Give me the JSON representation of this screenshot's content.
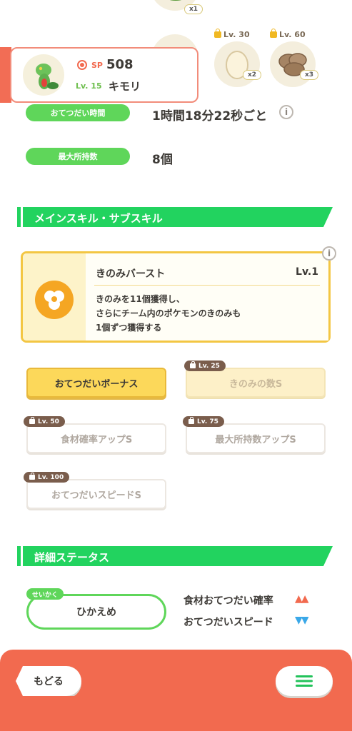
{
  "ingredients": {
    "items": [
      {
        "quantity": "x1"
      },
      {
        "unlock_level": "Lv. 30",
        "quantity": "x2"
      },
      {
        "unlock_level": "Lv. 60",
        "quantity": "x3"
      }
    ]
  },
  "pokemon": {
    "sp_label": "SP",
    "sp_value": "508",
    "level": "Lv. 15",
    "name": "キモリ"
  },
  "stats": {
    "help_time_label": "おてつだい時間",
    "help_time_value": "1時間18分22秒ごと",
    "max_carry_label": "最大所持数",
    "max_carry_value": "8個",
    "info_glyph": "i"
  },
  "skills_section": {
    "title": "メインスキル・サブスキル",
    "main_skill": {
      "name": "きのみバースト",
      "level": "Lv.1",
      "desc_line1": "きのみを11個獲得し、",
      "desc_line2": "さらにチーム内のポケモンのきのみも",
      "desc_line3": "1個ずつ獲得する"
    },
    "sub_skills": [
      {
        "label": "おてつだいボーナス",
        "unlock": ""
      },
      {
        "label": "きのみの数S",
        "unlock": "Lv. 25"
      },
      {
        "label": "食材確率アップS",
        "unlock": "Lv. 50"
      },
      {
        "label": "最大所持数アップS",
        "unlock": "Lv. 75"
      },
      {
        "label": "おてつだいスピードS",
        "unlock": "Lv. 100"
      }
    ]
  },
  "details_section": {
    "title": "詳細ステータス",
    "nature_tag": "せいかく",
    "nature_value": "ひかえめ",
    "up_stat": "食材おてつだい確率",
    "up_marks": "▲▲",
    "down_stat": "おてつだいスピード",
    "down_marks": "▼▼"
  },
  "footer": {
    "back_label": "もどる"
  },
  "colors": {
    "accent_green": "#22d35f",
    "pill_green": "#5fd65a",
    "footer_orange": "#f26a4f",
    "skill_gold": "#f3c643",
    "up_red": "#f26a4f",
    "down_blue": "#3aa8e8"
  }
}
